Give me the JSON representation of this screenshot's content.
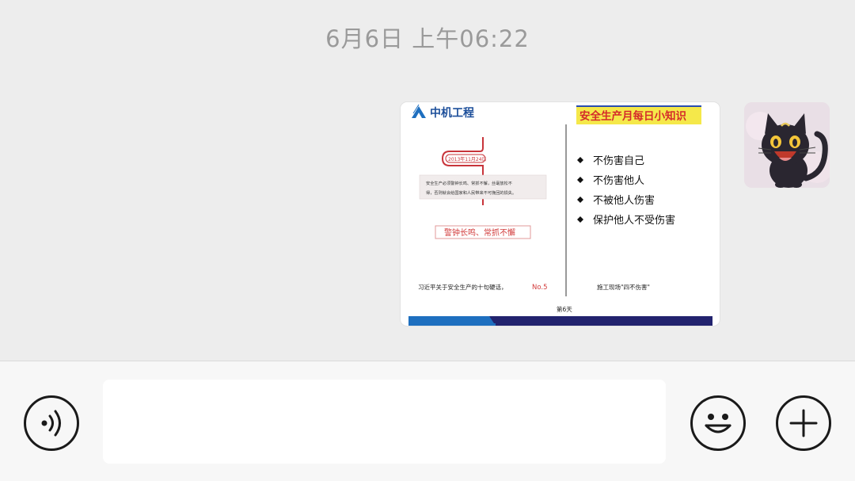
{
  "chat": {
    "timestamp": "6月6日 上午06:22"
  },
  "image_message": {
    "company_name": "中机工程",
    "banner_title": "安全生产月每日小知识",
    "date_tag": "2013年11月24日",
    "quote_line1": "安全生产必须警钟长鸣、常抓不懈，丝毫放松不",
    "quote_line2": "得，否则就会给国家和人民带来不可挽回的损失。",
    "highlight_slogan": "警钟长鸣、常抓不懈",
    "left_caption": "习近平关于安全生产的十句硬话，",
    "left_caption_no": "No.5",
    "bullets": [
      "不伤害自己",
      "不伤害他人",
      "不被他人伤害",
      "保护他人不受伤害"
    ],
    "right_caption": "施工现场\"四不伤害\"",
    "day_label": "第6天",
    "colors": {
      "blue": "#1e6fbf",
      "navy": "#22236e",
      "red": "#d23a3a",
      "yellow": "#f5e84a"
    }
  },
  "input_bar": {
    "voice_icon": "voice-icon",
    "emoji_icon": "emoji-icon",
    "plus_icon": "plus-icon",
    "message_value": ""
  }
}
